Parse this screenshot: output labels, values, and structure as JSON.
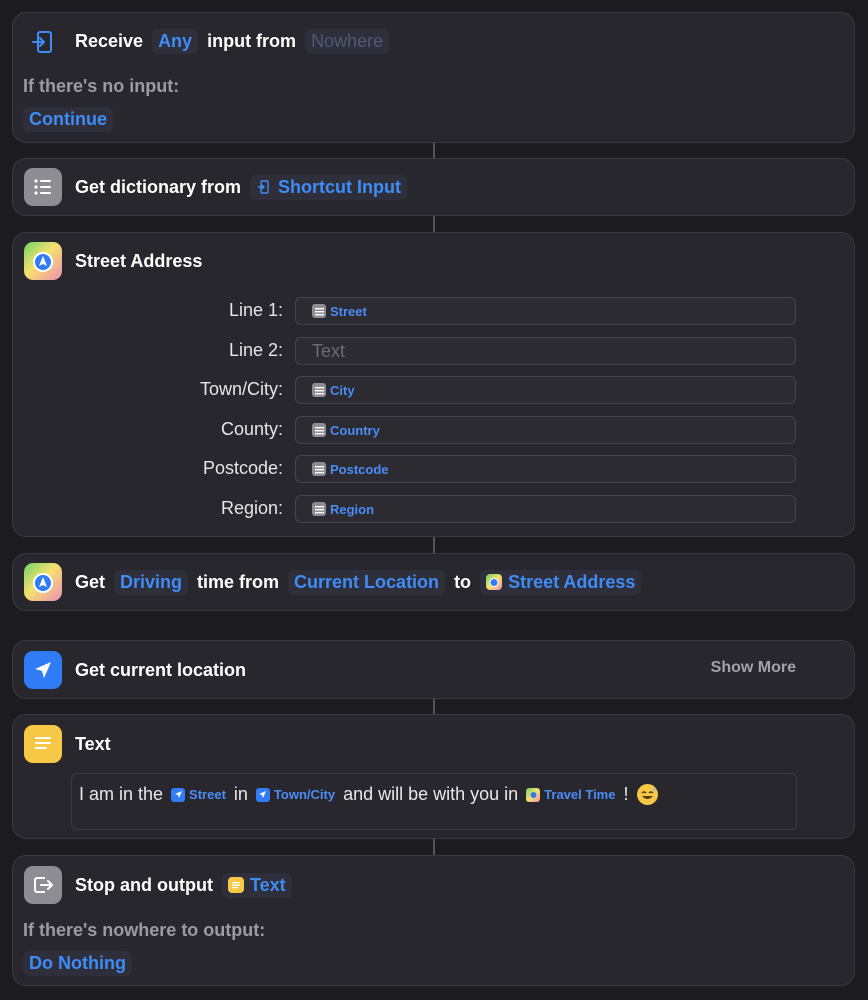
{
  "receive": {
    "word1": "Receive",
    "type_token": "Any",
    "word2": "input from",
    "source_token": "Nowhere",
    "no_input_label": "If there's no input:",
    "no_input_action": "Continue"
  },
  "get_dictionary": {
    "label": "Get dictionary from",
    "source_token": "Shortcut Input"
  },
  "street_address": {
    "title": "Street Address",
    "fields": [
      {
        "label": "Line 1:",
        "value": "Street",
        "placeholder": ""
      },
      {
        "label": "Line 2:",
        "value": "",
        "placeholder": "Text"
      },
      {
        "label": "Town/City:",
        "value": "City",
        "placeholder": ""
      },
      {
        "label": "County:",
        "value": "Country",
        "placeholder": ""
      },
      {
        "label": "Postcode:",
        "value": "Postcode",
        "placeholder": ""
      },
      {
        "label": "Region:",
        "value": "Region",
        "placeholder": ""
      }
    ]
  },
  "travel_time": {
    "word1": "Get",
    "mode_token": "Driving",
    "word2": "time from",
    "from_token": "Current Location",
    "word3": "to",
    "to_token": "Street Address"
  },
  "current_location": {
    "label": "Get current location",
    "show_more": "Show More"
  },
  "text_action": {
    "title": "Text",
    "segments": {
      "s1": "I am in the",
      "v1": "Street",
      "s2": "in",
      "v2": "Town/City",
      "s3": "and will be with you in",
      "v3": "Travel Time",
      "s4": "!"
    }
  },
  "stop_output": {
    "label": "Stop and output",
    "token": "Text",
    "nowhere_label": "If there's nowhere to output:",
    "nowhere_action": "Do Nothing"
  },
  "colors": {
    "background": "#1c1b20",
    "card": "#28272d",
    "accent": "#3f8cf6",
    "maps_icon": "#4cc35a",
    "location_icon": "#2f7cf6",
    "text_icon": "#f7c845",
    "dictionary_icon": "#8e8d93"
  },
  "icons": {
    "receive": "input-arrow-icon",
    "dictionary": "list-icon",
    "maps": "maps-icon",
    "location": "location-arrow-icon",
    "text": "notes-icon",
    "stop": "output-arrow-icon"
  }
}
